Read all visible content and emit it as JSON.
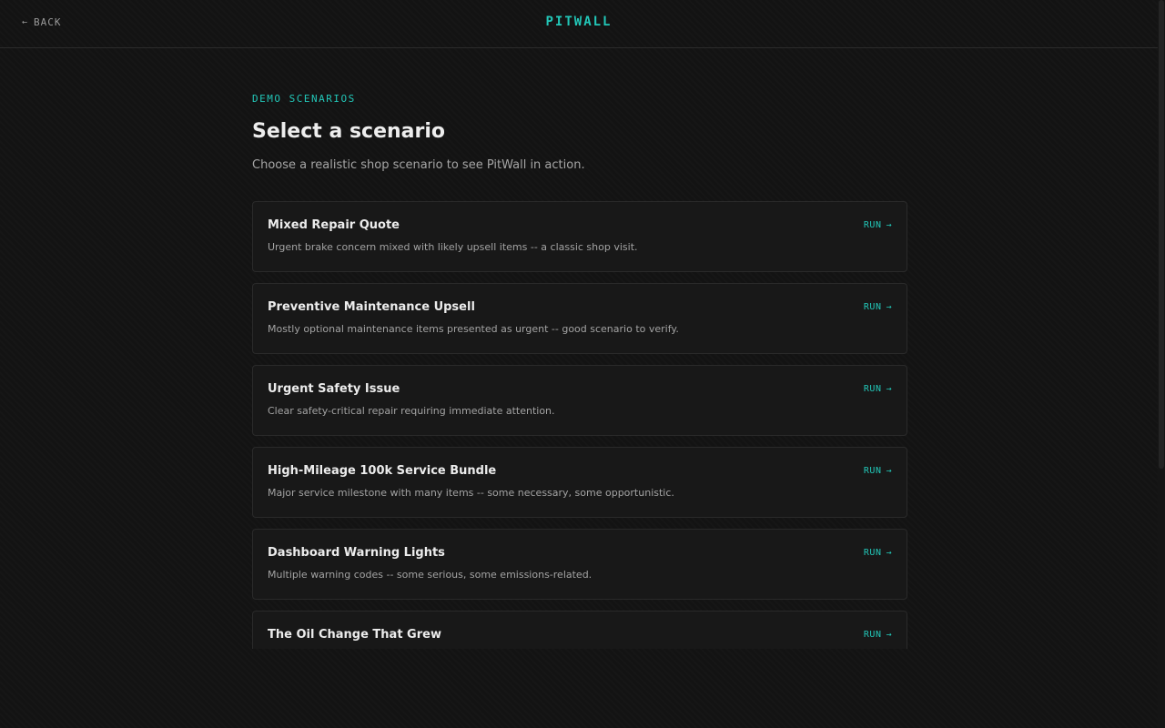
{
  "header": {
    "back_label": "BACK",
    "back_icon": "←",
    "brand": "PITWALL"
  },
  "main": {
    "eyebrow": "DEMO SCENARIOS",
    "title": "Select a scenario",
    "subtitle": "Choose a realistic shop scenario to see PitWall in action."
  },
  "scenarios": [
    {
      "title": "Mixed Repair Quote",
      "description": "Urgent brake concern mixed with likely upsell items -- a classic shop visit.",
      "action": "RUN"
    },
    {
      "title": "Preventive Maintenance Upsell",
      "description": "Mostly optional maintenance items presented as urgent -- good scenario to verify.",
      "action": "RUN"
    },
    {
      "title": "Urgent Safety Issue",
      "description": "Clear safety-critical repair requiring immediate attention.",
      "action": "RUN"
    },
    {
      "title": "High-Mileage 100k Service Bundle",
      "description": "Major service milestone with many items -- some necessary, some opportunistic.",
      "action": "RUN"
    },
    {
      "title": "Dashboard Warning Lights",
      "description": "Multiple warning codes -- some serious, some emissions-related.",
      "action": "RUN"
    },
    {
      "title": "The Oil Change That Grew",
      "description": "",
      "action": "RUN"
    }
  ],
  "icons": {
    "run_icon": "→"
  },
  "colors": {
    "accent": "#22c7b8",
    "background": "#131313",
    "card": "#181818"
  }
}
